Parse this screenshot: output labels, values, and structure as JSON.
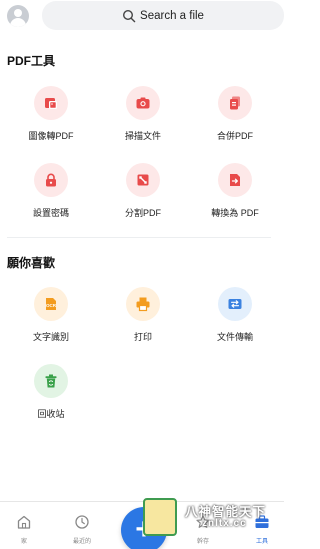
{
  "search": {
    "placeholder": "Search a file"
  },
  "sections": {
    "pdf_tools": {
      "title": "PDF工具",
      "items": [
        {
          "label": "圖像轉PDF",
          "icon": "image-to-pdf-icon"
        },
        {
          "label": "掃描文件",
          "icon": "camera-icon"
        },
        {
          "label": "合併PDF",
          "icon": "merge-pdf-icon"
        },
        {
          "label": "設置密碼",
          "icon": "lock-icon"
        },
        {
          "label": "分割PDF",
          "icon": "split-pdf-icon"
        },
        {
          "label": "轉換為 PDF",
          "icon": "convert-to-pdf-icon"
        }
      ]
    },
    "favorites": {
      "title": "願你喜歡",
      "items": [
        {
          "label": "文字識別",
          "icon": "ocr-icon"
        },
        {
          "label": "打印",
          "icon": "printer-icon"
        },
        {
          "label": "文件傳輸",
          "icon": "file-transfer-icon"
        },
        {
          "label": "回收站",
          "icon": "recycle-bin-icon"
        }
      ]
    }
  },
  "bottom_nav": {
    "items": [
      {
        "label": "家",
        "icon": "home-icon",
        "active": false
      },
      {
        "label": "最近的",
        "icon": "clock-icon",
        "active": false
      },
      {
        "label": "幹存",
        "icon": "star-icon",
        "active": false
      },
      {
        "label": "工具",
        "icon": "toolbox-icon",
        "active": true
      }
    ],
    "fab_label": "+"
  },
  "watermark": {
    "line1": "八神智能天下",
    "line2": "znltx.cc"
  },
  "colors": {
    "accent": "#2b77e4",
    "icon_red": "#e84b4b",
    "icon_orange": "#f39c1f",
    "icon_blue": "#3b82e0",
    "icon_green": "#3aa14a"
  }
}
